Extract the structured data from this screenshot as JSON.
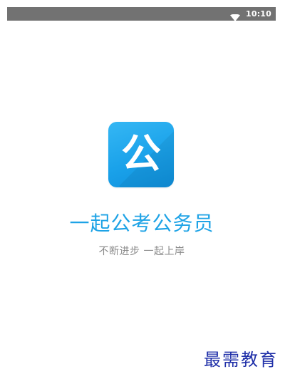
{
  "status_bar": {
    "time": "10:10",
    "icons": [
      "wifi-icon"
    ]
  },
  "app": {
    "icon_glyph": "公",
    "name": "一起公考公务员",
    "slogan": "不断进步 一起上岸"
  },
  "watermark": {
    "text": "最需教育"
  },
  "colors": {
    "status_bar_bg": "#727272",
    "icon_gradient_start": "#35b7f4",
    "icon_gradient_end": "#0f8fdc",
    "app_name": "#1ea3e6",
    "slogan": "#8a8a8a",
    "watermark": "#1f2fa8"
  }
}
